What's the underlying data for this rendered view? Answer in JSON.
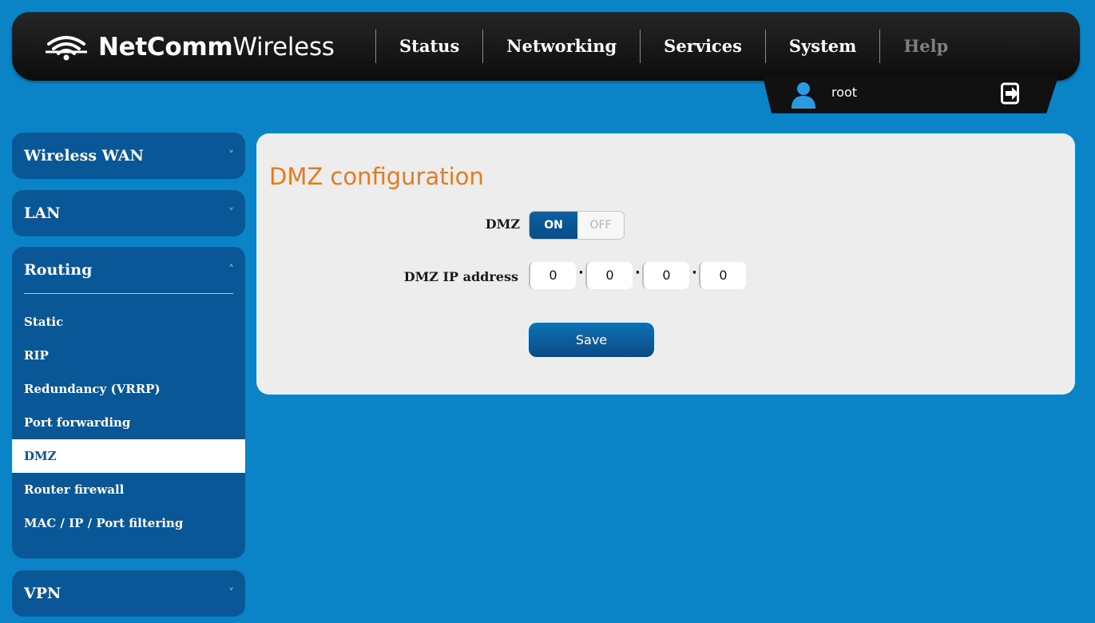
{
  "brand": {
    "name_bold": "NetComm",
    "name_light": "Wireless"
  },
  "nav": {
    "items": [
      {
        "label": "Status"
      },
      {
        "label": "Networking"
      },
      {
        "label": "Services"
      },
      {
        "label": "System"
      },
      {
        "label": "Help"
      }
    ]
  },
  "user": {
    "name": "root",
    "icon": "user-icon",
    "logout_icon": "logout-icon"
  },
  "sidebar": {
    "wireless_wan": "Wireless WAN",
    "lan": "LAN",
    "routing": {
      "label": "Routing",
      "items": [
        {
          "label": "Static"
        },
        {
          "label": "RIP"
        },
        {
          "label": "Redundancy (VRRP)"
        },
        {
          "label": "Port forwarding"
        },
        {
          "label": "DMZ",
          "active": true
        },
        {
          "label": "Router firewall"
        },
        {
          "label": "MAC / IP / Port filtering"
        }
      ]
    },
    "vpn": "VPN",
    "chevron_down": "˅",
    "chevron_up": "˄"
  },
  "main": {
    "title": "DMZ configuration",
    "dmz_label": "DMZ",
    "toggle_on": "ON",
    "toggle_off": "OFF",
    "ip_label": "DMZ IP address",
    "ip": [
      "0",
      "0",
      "0",
      "0"
    ],
    "save_label": "Save"
  },
  "colors": {
    "background": "#0a84c6",
    "sidebar": "#0a5798",
    "title": "#e37c21",
    "header": "#111111"
  }
}
